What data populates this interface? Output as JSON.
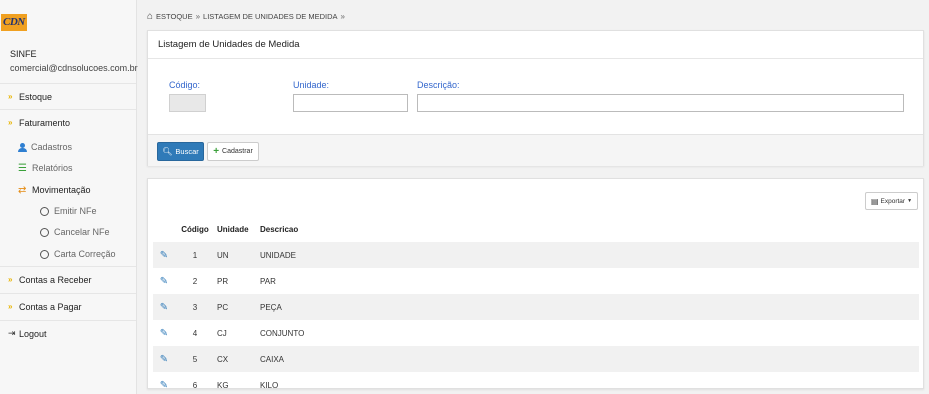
{
  "brand": {
    "logo_text": "CDN",
    "logo_color": "#f0a020"
  },
  "user": {
    "name": "SINFE",
    "email": "comercial@cdnsolucoes.com.br"
  },
  "sidebar": {
    "estoque": "Estoque",
    "faturamento": "Faturamento",
    "cadastros": "Cadastros",
    "relatorios": "Relatórios",
    "movimentacao": "Movimentação",
    "emitir": "Emitir NFe",
    "cancelar": "Cancelar NFe",
    "carta": "Carta Correção",
    "contas_receber": "Contas a Receber",
    "contas_pagar": "Contas a Pagar",
    "logout": "Logout"
  },
  "breadcrumb": {
    "item1": "ESTOQUE",
    "item2": "LISTAGEM DE UNIDADES DE MEDIDA",
    "separator": "»"
  },
  "search_panel": {
    "title": "Listagem de Unidades de Medida",
    "codigo_label": "Código:",
    "unidade_label": "Unidade:",
    "descricao_label": "Descrição:",
    "codigo_value": "",
    "unidade_value": "",
    "descricao_value": "",
    "buscar_label": "Buscar",
    "cadastrar_label": "Cadastrar"
  },
  "results_panel": {
    "exportar_label": "Exportar",
    "columns": [
      "Código",
      "Unidade",
      "Descricao"
    ],
    "rows": [
      {
        "codigo": "1",
        "unidade": "UN",
        "descricao": "UNIDADE"
      },
      {
        "codigo": "2",
        "unidade": "PR",
        "descricao": "PAR"
      },
      {
        "codigo": "3",
        "unidade": "PC",
        "descricao": "PEÇA"
      },
      {
        "codigo": "4",
        "unidade": "CJ",
        "descricao": "CONJUNTO"
      },
      {
        "codigo": "5",
        "unidade": "CX",
        "descricao": "CAIXA"
      },
      {
        "codigo": "6",
        "unidade": "KG",
        "descricao": "KILO"
      }
    ]
  },
  "colors": {
    "primary": "#2f7ab8",
    "accent": "#e8b400",
    "label_blue": "#3366cc"
  }
}
